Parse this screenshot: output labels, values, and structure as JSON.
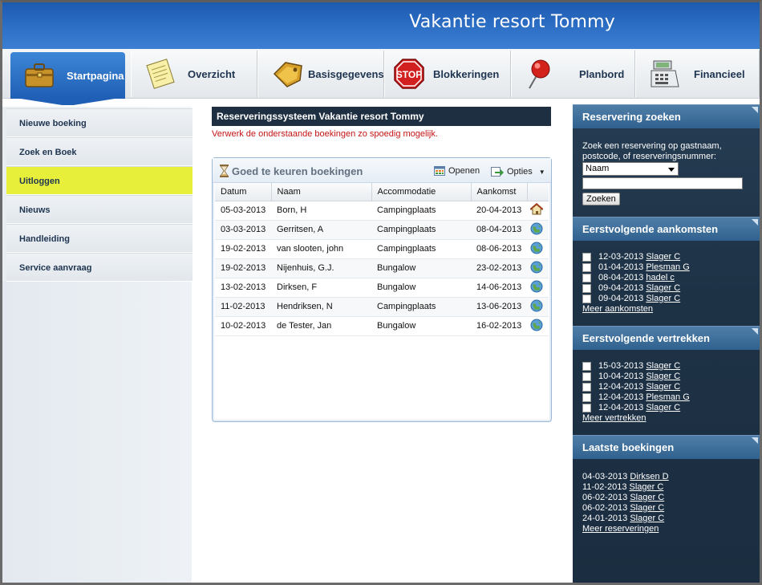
{
  "app": {
    "title": "Vakantie resort Tommy"
  },
  "tabs": [
    {
      "label": "Startpagina",
      "icon": "briefcase-icon",
      "active": true
    },
    {
      "label": "Overzicht",
      "icon": "notepad-icon"
    },
    {
      "label": "Basisgegevens",
      "icon": "tag-icon"
    },
    {
      "label": "Blokkeringen",
      "icon": "stop-sign-icon"
    },
    {
      "label": "Planbord",
      "icon": "pushpin-icon"
    },
    {
      "label": "Financieel",
      "icon": "cash-register-icon"
    }
  ],
  "sidebar": {
    "items": [
      {
        "label": "Nieuwe boeking"
      },
      {
        "label": "Zoek en Boek"
      },
      {
        "label": "Uitloggen"
      },
      {
        "label": "Nieuws"
      },
      {
        "label": "Handleiding"
      },
      {
        "label": "Service aanvraag"
      }
    ]
  },
  "main": {
    "title": "Reserveringssysteem Vakantie resort Tommy",
    "note": "Verwerk de onderstaande boekingen zo spoedig mogelijk.",
    "panel": {
      "title": "Goed te keuren boekingen",
      "open_label": "Openen",
      "options_label": "Opties",
      "columns": [
        "Datum",
        "Naam",
        "Accommodatie",
        "Aankomst"
      ],
      "rows": [
        {
          "date": "05-03-2013",
          "name": "Born, H",
          "acc": "Campingplaats",
          "arrival": "20-04-2013",
          "icon": "home-icon"
        },
        {
          "date": "03-03-2013",
          "name": "Gerritsen, A",
          "acc": "Campingplaats",
          "arrival": "08-04-2013",
          "icon": "globe-icon"
        },
        {
          "date": "19-02-2013",
          "name": "van slooten, john",
          "acc": "Campingplaats",
          "arrival": "08-06-2013",
          "icon": "globe-icon"
        },
        {
          "date": "19-02-2013",
          "name": "Nijenhuis, G.J.",
          "acc": "Bungalow",
          "arrival": "23-02-2013",
          "icon": "globe-icon"
        },
        {
          "date": "13-02-2013",
          "name": "Dirksen, F",
          "acc": "Bungalow",
          "arrival": "14-06-2013",
          "icon": "globe-icon"
        },
        {
          "date": "11-02-2013",
          "name": "Hendriksen, N",
          "acc": "Campingplaats",
          "arrival": "13-06-2013",
          "icon": "globe-icon"
        },
        {
          "date": "10-02-2013",
          "name": "de Tester, Jan",
          "acc": "Bungalow",
          "arrival": "16-02-2013",
          "icon": "globe-icon"
        }
      ]
    }
  },
  "right": {
    "search": {
      "title": "Reservering zoeken",
      "desc": "Zoek een reservering op gastnaam, postcode, of reserveringsnummer:",
      "select_value": "Naam",
      "button": "Zoeken"
    },
    "arrivals": {
      "title": "Eerstvolgende aankomsten",
      "items": [
        {
          "date": "12-03-2013",
          "name": "Slager C"
        },
        {
          "date": "01-04-2013",
          "name": "Plesman G"
        },
        {
          "date": "08-04-2013",
          "name": "hadel c"
        },
        {
          "date": "09-04-2013",
          "name": "Slager C"
        },
        {
          "date": "09-04-2013",
          "name": "Slager C"
        }
      ],
      "more": "Meer aankomsten"
    },
    "departures": {
      "title": "Eerstvolgende vertrekken",
      "items": [
        {
          "date": "15-03-2013",
          "name": "Slager C"
        },
        {
          "date": "10-04-2013",
          "name": "Slager C"
        },
        {
          "date": "12-04-2013",
          "name": "Slager C"
        },
        {
          "date": "12-04-2013",
          "name": "Plesman G"
        },
        {
          "date": "12-04-2013",
          "name": "Slager C"
        }
      ],
      "more": "Meer vertrekken"
    },
    "latest": {
      "title": "Laatste boekingen",
      "items": [
        {
          "date": "04-03-2013",
          "name": "Dirksen D"
        },
        {
          "date": "11-02-2013",
          "name": "Slager C"
        },
        {
          "date": "06-02-2013",
          "name": "Slager C"
        },
        {
          "date": "06-02-2013",
          "name": "Slager C"
        },
        {
          "date": "24-01-2013",
          "name": "Slager C"
        }
      ],
      "more": "Meer reserveringen"
    }
  }
}
